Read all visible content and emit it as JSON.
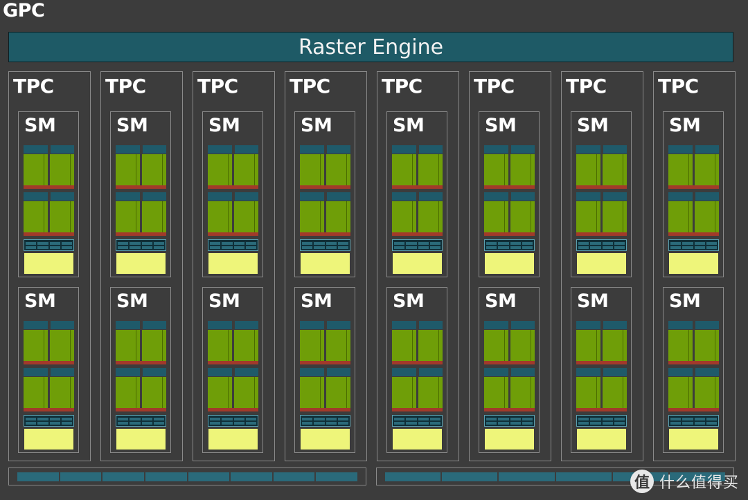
{
  "gpc_label": "GPC",
  "raster_label": "Raster Engine",
  "tpc_label": "TPC",
  "sm_label": "SM",
  "tpcs": [
    {
      "label": "TPC",
      "sms": [
        "SM",
        "SM"
      ]
    },
    {
      "label": "TPC",
      "sms": [
        "SM",
        "SM"
      ]
    },
    {
      "label": "TPC",
      "sms": [
        "SM",
        "SM"
      ]
    },
    {
      "label": "TPC",
      "sms": [
        "SM",
        "SM"
      ]
    },
    {
      "label": "TPC",
      "sms": [
        "SM",
        "SM"
      ]
    },
    {
      "label": "TPC",
      "sms": [
        "SM",
        "SM"
      ]
    },
    {
      "label": "TPC",
      "sms": [
        "SM",
        "SM"
      ]
    },
    {
      "label": "TPC",
      "sms": [
        "SM",
        "SM"
      ]
    }
  ],
  "watermark": {
    "icon": "值",
    "text": "什么值得买"
  },
  "colors": {
    "background": "#3c3c3c",
    "raster_engine": "#1e5a66",
    "cuda_core": "#6f9e08",
    "tensor_header": "#1f5a6a",
    "core_footer": "#a23a2a",
    "l1_cache": "#eef57a"
  }
}
